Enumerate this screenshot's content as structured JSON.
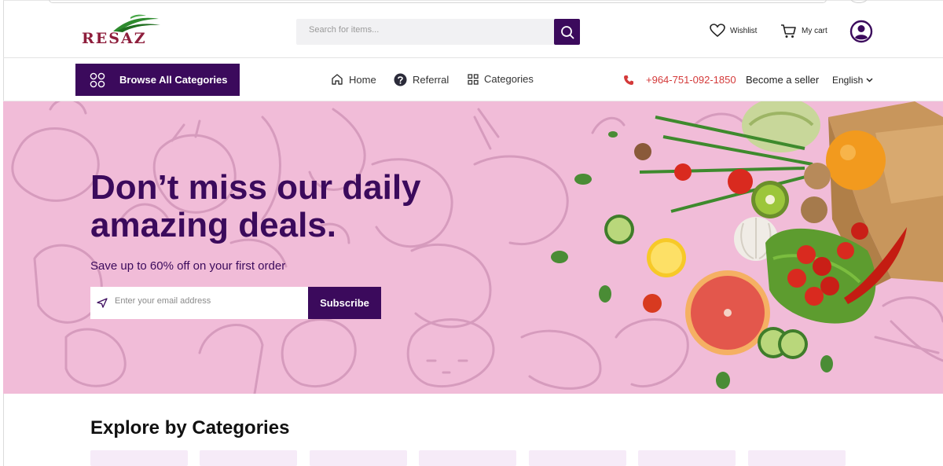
{
  "header": {
    "logo_text": "RESAZ",
    "search_placeholder": "Search for items...",
    "wishlist_label": "Wishlist",
    "cart_label": "My cart"
  },
  "nav": {
    "browse_label": "Browse All Categories",
    "home_label": "Home",
    "referral_label": "Referral",
    "categories_label": "Categories",
    "phone": "+964-751-092-1850",
    "seller_label": "Become a seller",
    "language": "English"
  },
  "hero": {
    "title_line1": "Don’t miss our daily",
    "title_line2": "amazing deals.",
    "subtitle": "Save up to 60% off on your first order",
    "email_placeholder": "Enter your email address",
    "subscribe_label": "Subscribe"
  },
  "categories": {
    "title": "Explore by Categories",
    "card_count": 7
  },
  "colors": {
    "brand_purple": "#3b0a5c",
    "hero_pink": "#f1bcd8",
    "phone_red": "#d43a3a",
    "logo_red": "#8e1e3c",
    "logo_green": "#2e8b2e"
  },
  "icons": [
    "search-icon",
    "heart-icon",
    "cart-icon",
    "user-icon",
    "grid-circles-icon",
    "home-icon",
    "help-circle-icon",
    "grid-squares-icon",
    "phone-icon",
    "chevron-down-icon",
    "send-icon"
  ]
}
